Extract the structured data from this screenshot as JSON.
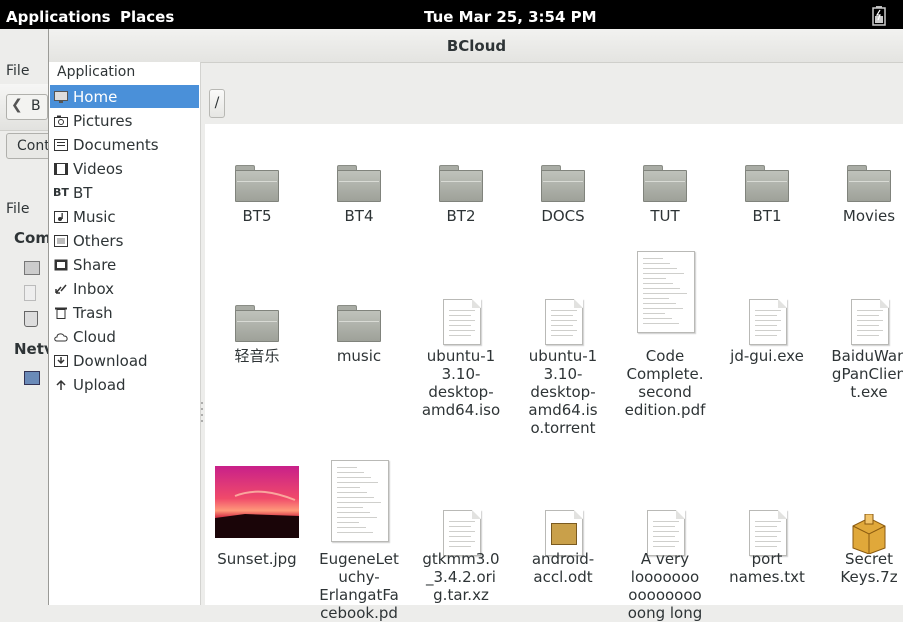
{
  "top_panel": {
    "applications_label": "Applications",
    "places_label": "Places",
    "clock": "Tue Mar 25,  3:54 PM"
  },
  "background_window": {
    "menu_file_1": "File",
    "menu_file_2": "File",
    "back_label": "B",
    "tab_label": "Cont",
    "section_computer": "Com",
    "section_network": "Netv"
  },
  "window": {
    "title": "BCloud",
    "sidebar_header": "Application",
    "path": "/"
  },
  "sidebar": {
    "items": [
      {
        "label": "Home",
        "icon": "monitor-icon"
      },
      {
        "label": "Pictures",
        "icon": "camera-icon"
      },
      {
        "label": "Documents",
        "icon": "document-icon"
      },
      {
        "label": "Videos",
        "icon": "film-icon"
      },
      {
        "label": "BT",
        "icon": "bt-icon"
      },
      {
        "label": "Music",
        "icon": "music-icon"
      },
      {
        "label": "Others",
        "icon": "others-icon"
      },
      {
        "label": "Share",
        "icon": "share-icon"
      },
      {
        "label": "Inbox",
        "icon": "inbox-icon"
      },
      {
        "label": "Trash",
        "icon": "trash-icon"
      },
      {
        "label": "Cloud",
        "icon": "cloud-icon"
      },
      {
        "label": "Download",
        "icon": "download-icon"
      },
      {
        "label": "Upload",
        "icon": "upload-icon"
      }
    ],
    "selected_color": "#4a90d9"
  },
  "files": [
    {
      "name": "BT5",
      "kind": "folder"
    },
    {
      "name": "BT4",
      "kind": "folder"
    },
    {
      "name": "BT2",
      "kind": "folder"
    },
    {
      "name": "DOCS",
      "kind": "folder"
    },
    {
      "name": "TUT",
      "kind": "folder"
    },
    {
      "name": "BT1",
      "kind": "folder"
    },
    {
      "name": "Movies",
      "kind": "folder"
    },
    {
      "name": "轻音乐",
      "kind": "folder"
    },
    {
      "name": "music",
      "kind": "folder"
    },
    {
      "name": "ubuntu-13.10-desktop-amd64.iso",
      "kind": "doc"
    },
    {
      "name": "ubuntu-13.10-desktop-amd64.iso.torrent",
      "kind": "doc"
    },
    {
      "name": "Code Complete.second edition.pdf",
      "kind": "pdf"
    },
    {
      "name": "jd-gui.exe",
      "kind": "doc"
    },
    {
      "name": "BaiduWangPanClient.exe",
      "kind": "doc"
    },
    {
      "name": "Sunset.jpg",
      "kind": "image"
    },
    {
      "name": "EugeneLetuchy-ErlangatFacebook.pdf",
      "kind": "pdf"
    },
    {
      "name": "gtkmm3.0_3.4.2.orig.tar.xz",
      "kind": "doc"
    },
    {
      "name": "android-accl.odt",
      "kind": "odt"
    },
    {
      "name": "A very loooooooooooooooooong long",
      "kind": "doc"
    },
    {
      "name": "port names.txt",
      "kind": "doc"
    },
    {
      "name": "Secret Keys.7z",
      "kind": "archive"
    }
  ],
  "file_labels": [
    "BT5",
    "BT4",
    "BT2",
    "DOCS",
    "TUT",
    "BT1",
    "Movies",
    "轻音乐",
    "music",
    "ubuntu-1\n3.10-\ndesktop-\namd64.iso",
    "ubuntu-1\n3.10-\ndesktop-\namd64.is\no.torrent",
    "Code\nComplete.\nsecond\nedition.pdf",
    "jd-gui.exe",
    "BaiduWan\ngPanClien\nt.exe",
    "Sunset.jpg",
    "EugeneLet\nuchy-\nErlangatFa\ncebook.pd",
    "gtkmm3.0\n_3.4.2.ori\ng.tar.xz",
    "android-\naccl.odt",
    "A very\nlooooooo\noooooooo\noong long",
    "port\nnames.txt",
    "Secret\nKeys.7z"
  ]
}
